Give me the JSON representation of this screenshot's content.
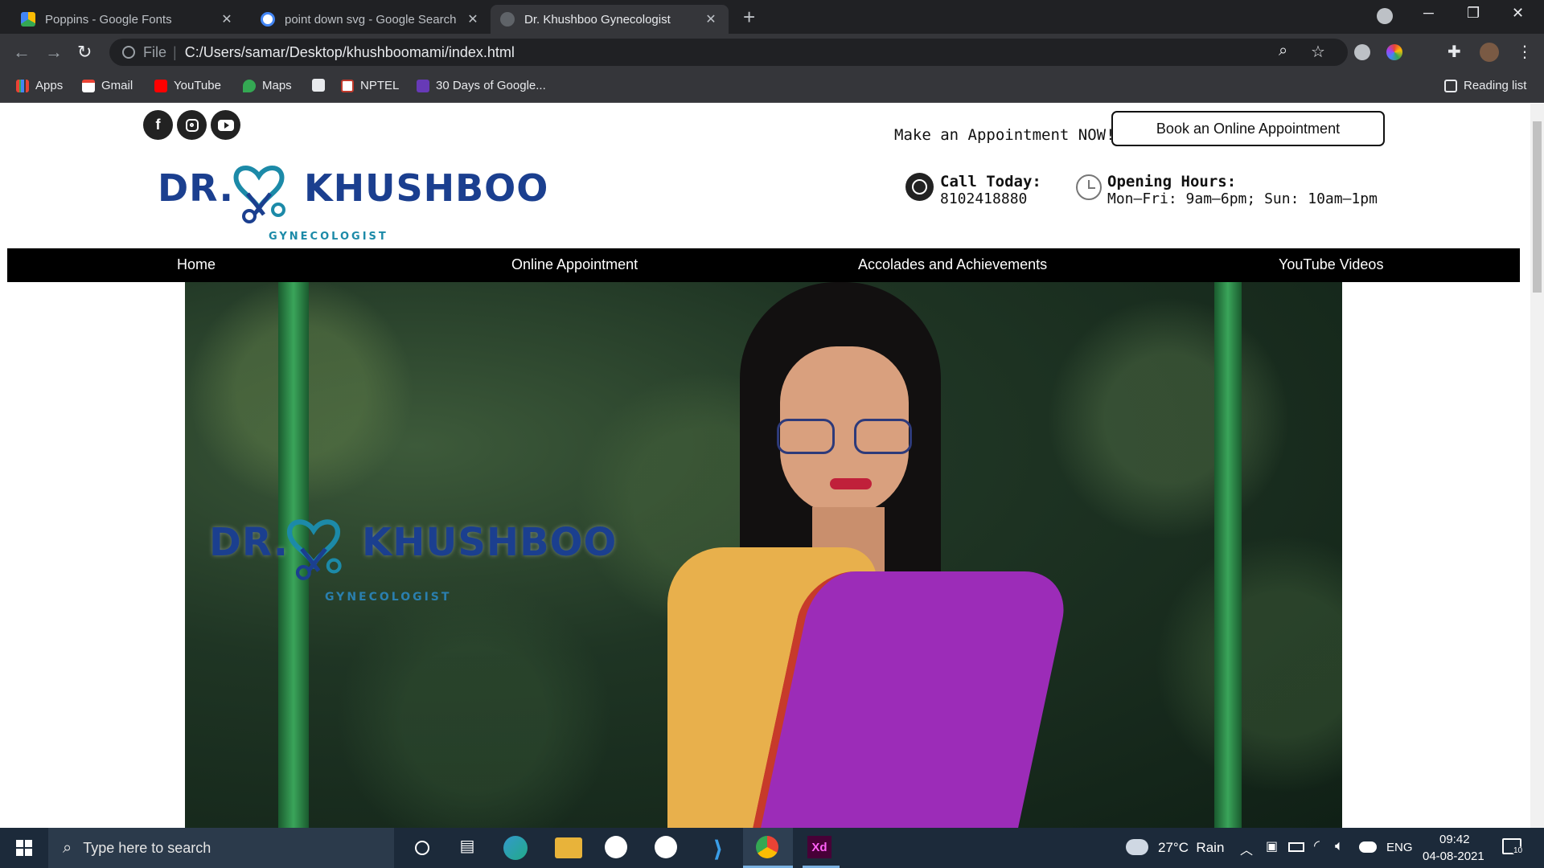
{
  "browser": {
    "tabs": [
      {
        "title": "Poppins - Google Fonts",
        "active": false
      },
      {
        "title": "point down svg - Google Search",
        "active": false
      },
      {
        "title": "Dr. Khushboo Gynecologist",
        "active": true
      }
    ],
    "address": {
      "scheme": "File",
      "url": "C:/Users/samar/Desktop/khushboomami/index.html"
    },
    "bookmarks": [
      "Apps",
      "Gmail",
      "YouTube",
      "Maps",
      "NPTEL",
      "30 Days of Google..."
    ],
    "reading_list": "Reading list"
  },
  "site": {
    "appointment_prompt": "Make an Appointment NOW!",
    "appointment_button": "Book an Online Appointment",
    "logo": {
      "dr": "DR.",
      "name": "KHUSHBOO",
      "subtitle": "GYNECOLOGIST"
    },
    "call": {
      "label": "Call Today:",
      "value": "8102418880"
    },
    "hours": {
      "label": "Opening Hours:",
      "value": "Mon–Fri: 9am–6pm; Sun: 10am–1pm"
    },
    "nav": [
      "Home",
      "Online Appointment",
      "Accolades and Achievements",
      "YouTube Videos"
    ],
    "hero_logo": {
      "dr": "DR.",
      "name": "KHUSHBOO",
      "subtitle": "GYNECOLOGIST"
    }
  },
  "taskbar": {
    "search_placeholder": "Type here to search",
    "weather": "27°C  Rain",
    "language": "ENG",
    "time": "09:42",
    "date": "04-08-2021",
    "notifications": "10"
  },
  "colors": {
    "logo_blue": "#1b3f8f",
    "logo_teal": "#1c8aa8",
    "nav_bg": "#000000"
  }
}
